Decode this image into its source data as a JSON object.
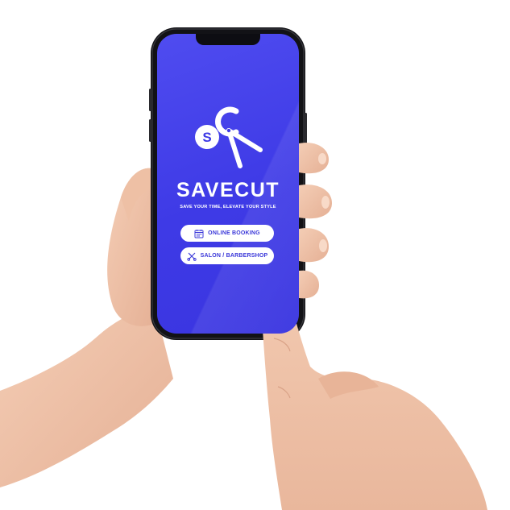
{
  "app": {
    "logo_letters": {
      "first": "S",
      "second": "C"
    },
    "brand_name": "SAVECUT",
    "tagline": "SAVE YOUR TIME, ELEVATE YOUR STYLE",
    "buttons": [
      {
        "label": "ONLINE BOOKING",
        "icon": "calendar-icon"
      },
      {
        "label": "SALON / BARBERSHOP",
        "icon": "scissors-comb-icon"
      }
    ]
  },
  "colors": {
    "screen_background": "#3e3ae6",
    "button_background": "#ffffff",
    "button_text": "#3a37d9",
    "brand_text": "#ffffff"
  }
}
